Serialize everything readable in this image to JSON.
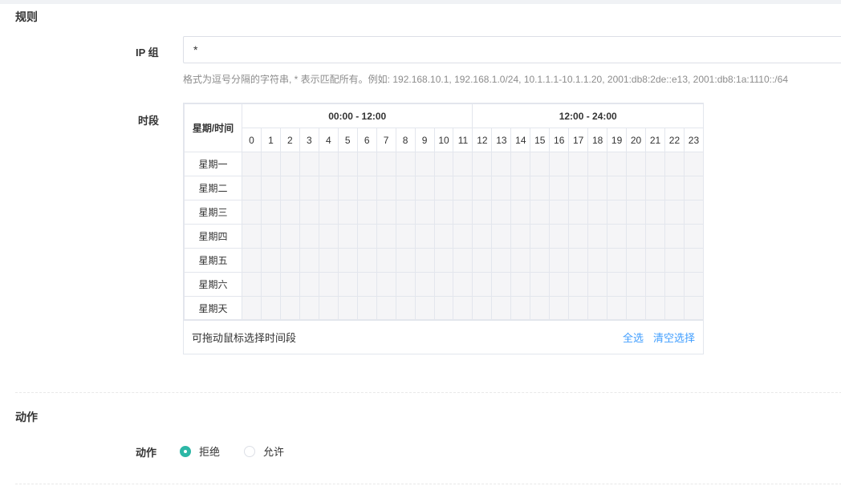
{
  "rules": {
    "section_title": "规则",
    "ip_group": {
      "label": "IP 组",
      "value": "*",
      "hint": "格式为逗号分隔的字符串, * 表示匹配所有。例如: 192.168.10.1, 192.168.1.0/24, 10.1.1.1-10.1.1.20, 2001:db8:2de::e13, 2001:db8:1a:1110::/64"
    },
    "period": {
      "label": "时段",
      "corner_header": "星期/时间",
      "group_headers": [
        "00:00 - 12:00",
        "12:00 - 24:00"
      ],
      "hours": [
        "0",
        "1",
        "2",
        "3",
        "4",
        "5",
        "6",
        "7",
        "8",
        "9",
        "10",
        "11",
        "12",
        "13",
        "14",
        "15",
        "16",
        "17",
        "18",
        "19",
        "20",
        "21",
        "22",
        "23"
      ],
      "days": [
        "星期一",
        "星期二",
        "星期三",
        "星期四",
        "星期五",
        "星期六",
        "星期天"
      ],
      "selected": [],
      "footer_tip": "可拖动鼠标选择时间段",
      "select_all": "全选",
      "clear_selection": "清空选择"
    }
  },
  "action": {
    "section_title": "动作",
    "label": "动作",
    "options": [
      {
        "label": "拒绝",
        "checked": true
      },
      {
        "label": "允许",
        "checked": false
      }
    ]
  },
  "colors": {
    "accent": "#2db7a6",
    "link": "#409eff",
    "slot_empty": "#f5f5f7"
  }
}
